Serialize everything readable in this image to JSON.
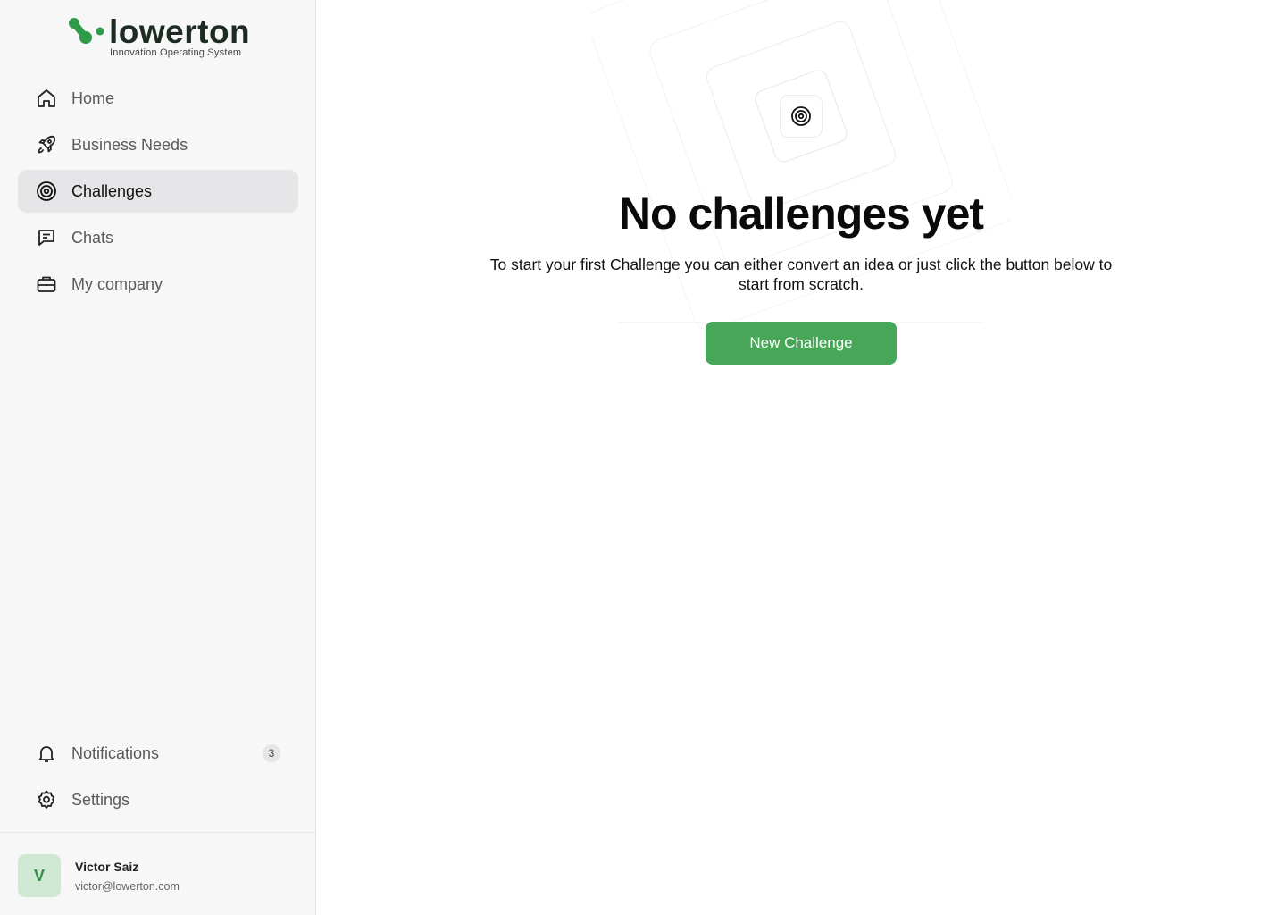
{
  "brand": {
    "name": "lowerton",
    "tagline": "Innovation Operating System",
    "accent_color": "#47a657"
  },
  "sidebar": {
    "items": [
      {
        "label": "Home",
        "icon": "home-icon",
        "active": false
      },
      {
        "label": "Business Needs",
        "icon": "rocket-icon",
        "active": false
      },
      {
        "label": "Challenges",
        "icon": "target-icon",
        "active": true
      },
      {
        "label": "Chats",
        "icon": "chat-icon",
        "active": false
      },
      {
        "label": "My company",
        "icon": "briefcase-icon",
        "active": false
      }
    ],
    "bottom_items": [
      {
        "label": "Notifications",
        "icon": "bell-icon",
        "badge": "3"
      },
      {
        "label": "Settings",
        "icon": "gear-icon"
      }
    ]
  },
  "user": {
    "initial": "V",
    "name": "Victor Saiz",
    "email": "victor@lowerton.com"
  },
  "main": {
    "icon": "target-icon",
    "title": "No challenges yet",
    "description": "To start your first Challenge you can either convert an idea or just click the button below to start from scratch.",
    "button_label": "New Challenge"
  }
}
